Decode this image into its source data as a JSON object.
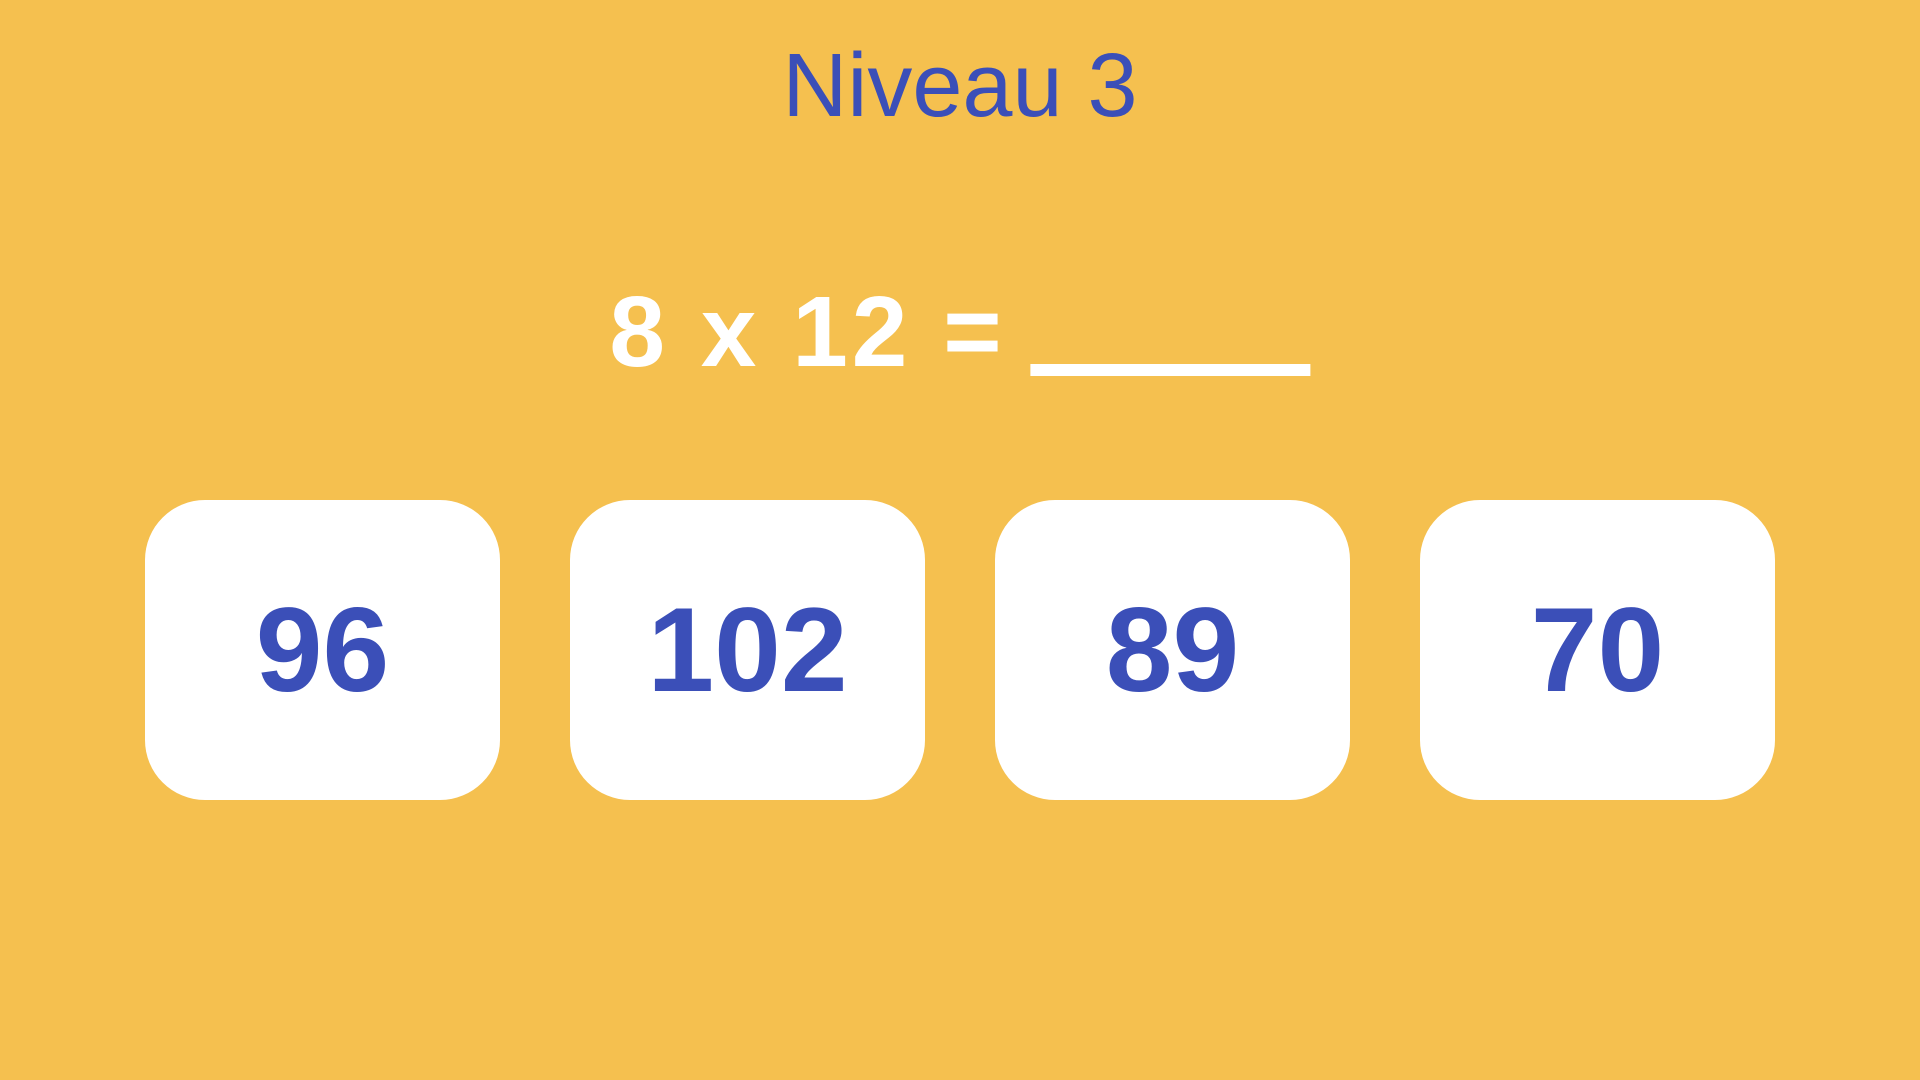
{
  "header": {
    "title": "Niveau 3"
  },
  "question": {
    "operand1": 8,
    "operator": "x",
    "operand2": 12,
    "display": "8 x 12 ="
  },
  "options": [
    {
      "value": 96
    },
    {
      "value": 102
    },
    {
      "value": 89
    },
    {
      "value": 70
    }
  ]
}
